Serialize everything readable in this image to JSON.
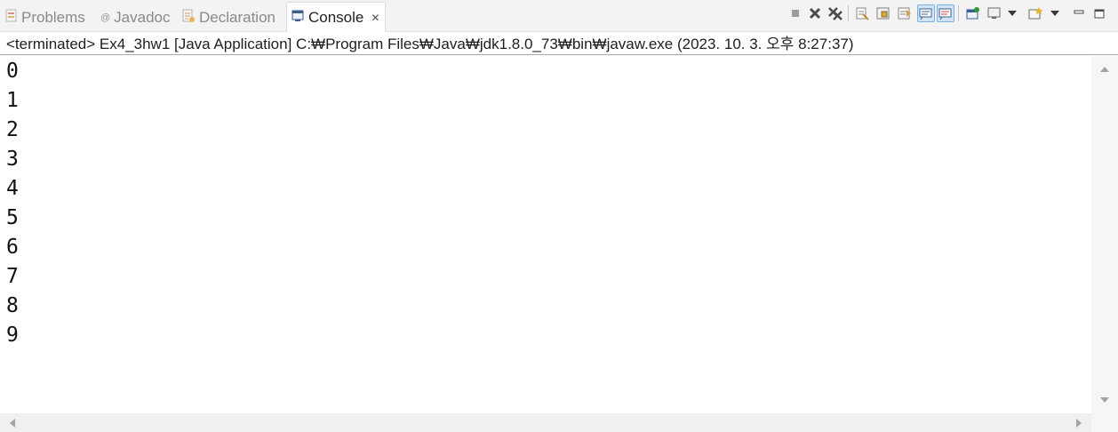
{
  "tabs": [
    {
      "label": "Problems",
      "icon": "problems-icon"
    },
    {
      "label": "Javadoc",
      "icon": "javadoc-icon"
    },
    {
      "label": "Declaration",
      "icon": "declaration-icon"
    },
    {
      "label": "Console",
      "icon": "console-icon",
      "active": true
    }
  ],
  "tab_close_glyph": "✕",
  "toolbar": {
    "icons": [
      "terminate-icon",
      "remove-launch-icon",
      "remove-all-terminated-icon",
      "clear-console-icon",
      "scroll-lock-icon",
      "word-wrap-icon",
      "show-on-stdout-icon",
      "show-on-stderr-icon",
      "pin-console-icon",
      "display-selected-console-icon",
      "open-console-icon",
      "minimize-icon",
      "maximize-icon"
    ]
  },
  "status": {
    "text": "<terminated> Ex4_3hw1 [Java Application] C:₩Program Files₩Java₩jdk1.8.0_73₩bin₩javaw.exe (2023. 10. 3. 오후 8:27:37)"
  },
  "console": {
    "lines": [
      "0",
      "1",
      "2",
      "3",
      "4",
      "5",
      "6",
      "7",
      "8",
      "9"
    ]
  },
  "colors": {
    "background": "#ffffff",
    "tabbar": "#f3f3f3",
    "output_text": "#111111",
    "inactive_tab_text": "#8a8a8a"
  }
}
